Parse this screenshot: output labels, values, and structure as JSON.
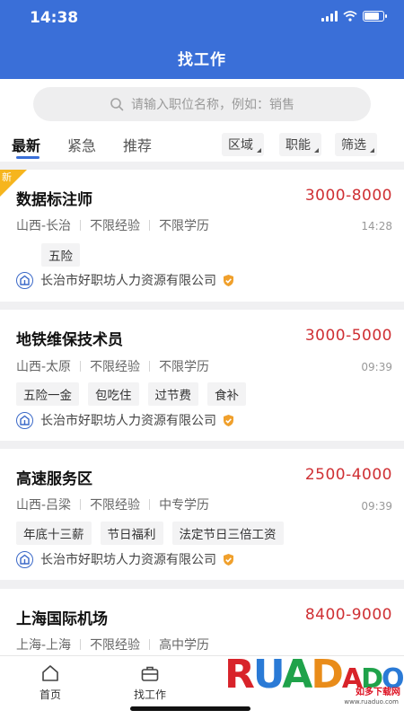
{
  "status": {
    "time": "14:38"
  },
  "header": {
    "title": "找工作"
  },
  "search": {
    "placeholder": "请输入职位名称，例如：销售"
  },
  "tabs": [
    {
      "label": "最新"
    },
    {
      "label": "紧急"
    },
    {
      "label": "推荐"
    }
  ],
  "filters": [
    {
      "label": "区域"
    },
    {
      "label": "职能"
    },
    {
      "label": "筛选"
    }
  ],
  "jobs": [
    {
      "badge": "新",
      "title": "数据标注师",
      "salary": "3000-8000",
      "location": "山西-长治",
      "experience": "不限经验",
      "education": "不限学历",
      "time": "14:28",
      "tags": [
        "五险"
      ],
      "company": "长治市好职坊人力资源有限公司"
    },
    {
      "title": "地铁维保技术员",
      "salary": "3000-5000",
      "location": "山西-太原",
      "experience": "不限经验",
      "education": "不限学历",
      "time": "09:39",
      "tags": [
        "五险一金",
        "包吃住",
        "过节费",
        "食补"
      ],
      "company": "长治市好职坊人力资源有限公司"
    },
    {
      "title": "高速服务区",
      "salary": "2500-4000",
      "location": "山西-吕梁",
      "experience": "不限经验",
      "education": "中专学历",
      "time": "09:39",
      "tags": [
        "年底十三薪",
        "节日福利",
        "法定节日三倍工资"
      ],
      "company": "长治市好职坊人力资源有限公司"
    },
    {
      "title": "上海国际机场",
      "salary": "8400-9000",
      "location": "上海-上海",
      "experience": "不限经验",
      "education": "高中学历"
    }
  ],
  "tabbar": [
    {
      "label": "首页",
      "icon": "home-icon"
    },
    {
      "label": "找工作",
      "icon": "briefcase-icon"
    }
  ],
  "watermark": {
    "brand": "RUADADO",
    "sub": "如多下载网",
    "url": "www.ruaduo.com"
  },
  "colors": {
    "primary": "#3a6fd8",
    "salary": "#cf2f33",
    "ribbon": "#f6b51e",
    "verify": "#f0a02c"
  }
}
